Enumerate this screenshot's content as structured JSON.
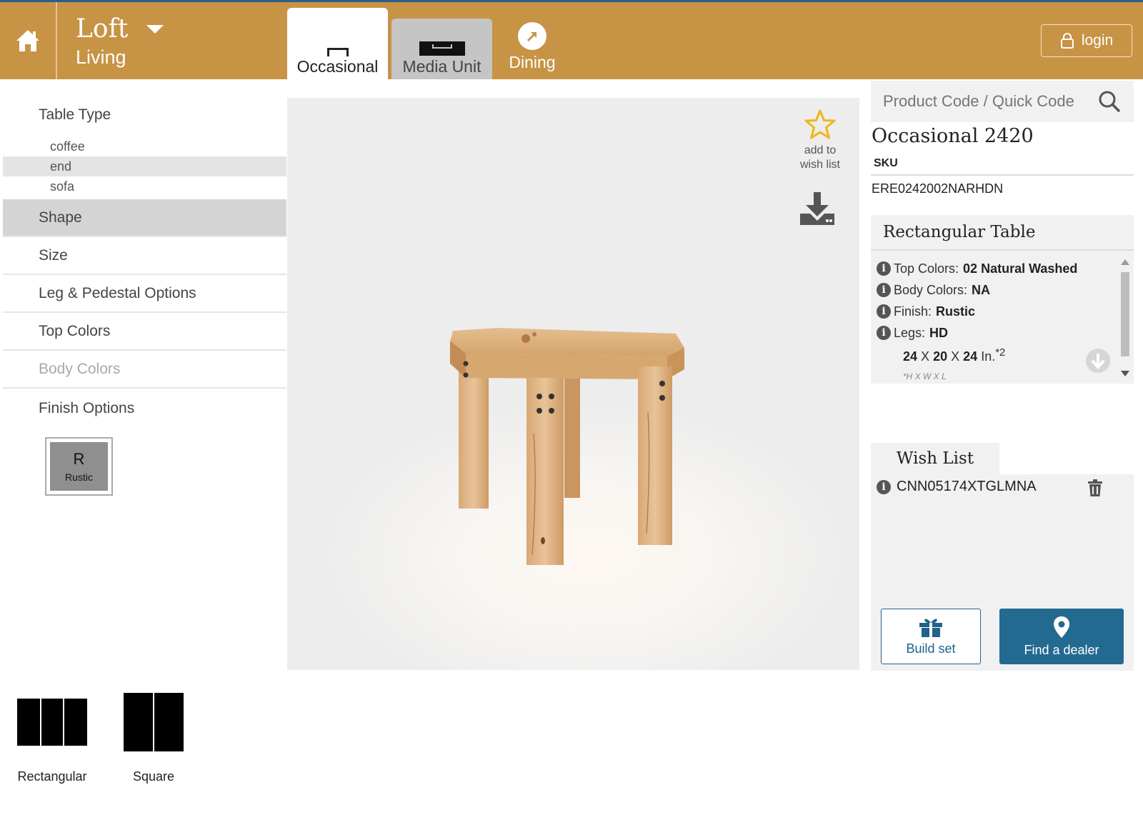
{
  "header": {
    "brand_name": "Loft",
    "brand_sub": "Living",
    "tabs": [
      {
        "label": "Occasional",
        "icon": "table-icon",
        "active": true
      },
      {
        "label": "Media Unit",
        "icon": "media-unit-icon",
        "active": false
      },
      {
        "label": "Dining",
        "icon": "arrow-circle-icon",
        "active": false
      }
    ],
    "login_label": "login",
    "accent_color": "#c79345"
  },
  "sidebar": {
    "table_type_title": "Table Type",
    "table_types": [
      "coffee",
      "end",
      "sofa"
    ],
    "selected_table_type": "end",
    "sections": [
      "Shape",
      "Size",
      "Leg & Pedestal Options",
      "Top Colors",
      "Body Colors",
      "Finish Options"
    ],
    "active_section": "Shape",
    "disabled_section": "Body Colors",
    "finish": {
      "letter": "R",
      "name": "Rustic"
    }
  },
  "shapes": [
    {
      "label": "Rectangular",
      "icon": "rectangular-shape-icon"
    },
    {
      "label": "Square",
      "icon": "square-shape-icon"
    }
  ],
  "viewer": {
    "wish_add_line1": "add to",
    "wish_add_line2": "wish list"
  },
  "search": {
    "placeholder": "Product Code / Quick Code"
  },
  "product": {
    "title": "Occasional 2420",
    "sku_label": "SKU",
    "sku": "ERE0242002NARHDN"
  },
  "specs": {
    "title": "Rectangular Table",
    "rows": [
      {
        "label": "Top Colors:",
        "value": "02 Natural Washed"
      },
      {
        "label": "Body Colors:",
        "value": "NA"
      },
      {
        "label": "Finish:",
        "value": "Rustic"
      },
      {
        "label": "Legs:",
        "value": "HD"
      }
    ],
    "dims": {
      "h": "24",
      "w": "20",
      "l": "24",
      "x": "X",
      "unit": "In.",
      "sup": "*2"
    },
    "dims_note": "*H X W X L"
  },
  "wishlist": {
    "title": "Wish List",
    "items": [
      "CNN05174XTGLMNA"
    ],
    "build_label": "Build set",
    "dealer_label": "Find a dealer",
    "button_color": "#236a91"
  }
}
